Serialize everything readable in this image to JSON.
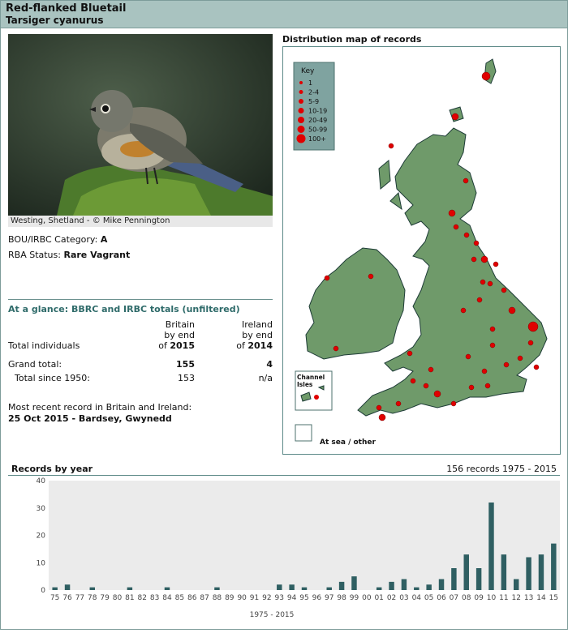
{
  "header": {
    "title": "Red-flanked Bluetail",
    "scientific": "Tarsiger cyanurus"
  },
  "photo": {
    "caption": "Westing, Shetland - © Mike Pennington"
  },
  "category": {
    "label": "BOU/IRBC Category:",
    "value": "A"
  },
  "rba": {
    "label": "RBA Status:",
    "value": "Rare Vagrant"
  },
  "glance": {
    "title": "At a glance: BBRC and IRBC totals (unfiltered)",
    "col_britain_1": "Britain",
    "col_britain_2": "by end",
    "col_britain_3": "of",
    "britain_year": "2015",
    "col_ireland_1": "Ireland",
    "col_ireland_2": "by end",
    "col_ireland_3": "of",
    "ireland_year": "2014",
    "row_individuals": "Total individuals",
    "row_grand": "Grand total:",
    "grand_britain": "155",
    "grand_ireland": "4",
    "row_since": "Total since 1950:",
    "since_britain": "153",
    "since_ireland": "n/a",
    "recent_label": "Most recent record in Britain and Ireland:",
    "recent_value": "25 Oct 2015  - Bardsey, Gwynedd"
  },
  "map": {
    "title": "Distribution map of records",
    "key_title": "Key",
    "key_items": [
      "1",
      "2-4",
      "5-9",
      "10-19",
      "20-49",
      "50-99",
      "100+"
    ],
    "channel_label_1": "Channel",
    "channel_label_2": "Isles",
    "sea_label": "At sea / other",
    "land_color": "#6f9a6a",
    "dot_color": "#e00000",
    "key_bg": "#7fa3a0"
  },
  "records": {
    "title": "Records by year",
    "count_text": "156 records 1975 - 2015"
  },
  "chart_data": {
    "type": "bar",
    "categories": [
      "75",
      "76",
      "77",
      "78",
      "79",
      "80",
      "81",
      "82",
      "83",
      "84",
      "85",
      "86",
      "87",
      "88",
      "89",
      "90",
      "91",
      "92",
      "93",
      "94",
      "95",
      "96",
      "97",
      "98",
      "99",
      "00",
      "01",
      "02",
      "03",
      "04",
      "05",
      "06",
      "07",
      "08",
      "09",
      "10",
      "11",
      "12",
      "13",
      "14",
      "15"
    ],
    "values": [
      1,
      2,
      0,
      1,
      0,
      0,
      1,
      0,
      0,
      1,
      0,
      0,
      0,
      1,
      0,
      0,
      0,
      0,
      2,
      2,
      1,
      0,
      1,
      3,
      5,
      0,
      1,
      3,
      4,
      1,
      2,
      4,
      8,
      13,
      8,
      32,
      13,
      4,
      12,
      13,
      17
    ],
    "xlabel": "1975 - 2015",
    "ylabel": "",
    "ylim": [
      0,
      40
    ],
    "yticks": [
      0,
      10,
      20,
      30,
      40
    ],
    "bar_color": "#2f5f62",
    "grid": false
  }
}
